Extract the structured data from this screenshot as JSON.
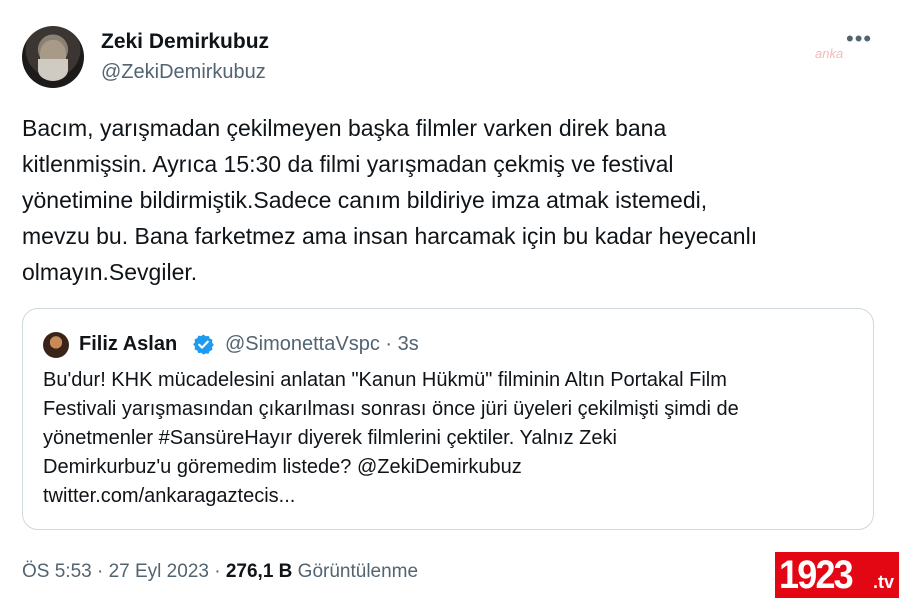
{
  "author": {
    "name": "Zeki Demirkubuz",
    "handle": "@ZekiDemirkubuz"
  },
  "more_icon": "more-dots-icon",
  "watermark": "anka",
  "tweet_text": "Bacım, yarışmadan çekilmeyen başka filmler varken direk bana\nkitlenmişsin. Ayrıca 15:30 da filmi yarışmadan çekmiş ve festival\nyönetimine bildirmiştik.Sadece canım bildiriye imza atmak istemedi,\nmevzu bu. Bana farketmez ama insan harcamak için bu kadar heyecanlı\nolmayın.Sevgiler.",
  "quote": {
    "name": "Filiz Aslan",
    "handle_time": "@SimonettaVspc · 3s",
    "verified_icon": "verified-badge-icon",
    "text": "Bu'dur! KHK mücadelesini anlatan \"Kanun Hükmü\" filminin Altın Portakal Film\nFestivali yarışmasından çıkarılması sonrası önce jüri üyeleri çekilmişti şimdi de\nyönetmenler #SansüreHayır diyerek filmlerini çektiler. Yalnız Zeki\nDemirkurbuz'u göremedim listede? @ZekiDemirkubuz\ntwitter.com/ankaragaztecis..."
  },
  "meta": {
    "time_date": "ÖS 5:53 · 27 Eyl 2023 · ",
    "views_count": "276,1 B",
    "views_label": " Görüntülenme"
  },
  "logo": {
    "number": "1923",
    "suffix": ".tv",
    "color": "#e30613"
  }
}
